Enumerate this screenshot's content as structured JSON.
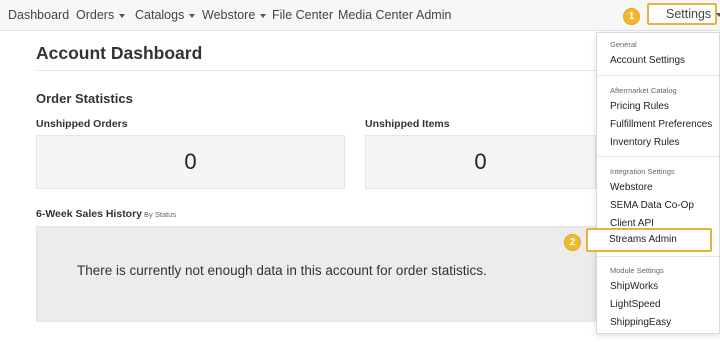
{
  "nav": {
    "items": [
      {
        "label": "Dashboard"
      },
      {
        "label": "Orders"
      },
      {
        "label": "Catalogs"
      },
      {
        "label": "Webstore"
      },
      {
        "label": "File Center"
      },
      {
        "label": "Media Center"
      },
      {
        "label": "Admin"
      }
    ],
    "settings_label": "Settings",
    "accent_color": "#e3b53a"
  },
  "badges": [
    "1",
    "2"
  ],
  "main": {
    "title": "Account Dashboard",
    "order_stats_title": "Order Statistics",
    "unshipped_orders_label": "Unshipped Orders",
    "unshipped_orders_value": "0",
    "unshipped_items_label": "Unshipped Items",
    "unshipped_items_value": "0",
    "sales_history_title": "6-Week Sales History",
    "sales_history_subtitle": "By Status",
    "sales_history_message": "There is currently not enough data in this account for order statistics."
  },
  "dropdown": {
    "general_header": "General",
    "account_settings": "Account Settings",
    "aftermarket_header": "Aftermarket Catalog",
    "pricing_rules": "Pricing Rules",
    "fulfillment_preferences": "Fulfillment Preferences",
    "inventory_rules": "Inventory Rules",
    "integration_header": "Integration Settings",
    "webstore": "Webstore",
    "sema_data_coop": "SEMA Data Co-Op",
    "client_api": "Client API",
    "streams_admin": "Streams Admin",
    "module_header": "Module Settings",
    "shipworks": "ShipWorks",
    "lightspeed": "LightSpeed",
    "shippingeasy": "ShippingEasy"
  }
}
